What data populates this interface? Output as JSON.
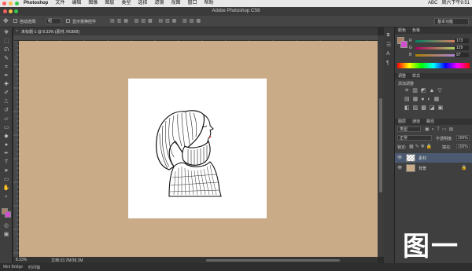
{
  "menubar": {
    "app_name": "Photoshop",
    "items": [
      "文件",
      "编辑",
      "图像",
      "图层",
      "类型",
      "选择",
      "滤镜",
      "视图",
      "窗口",
      "帮助"
    ],
    "right": [
      "ABC",
      "周六下午9:51"
    ]
  },
  "window": {
    "title": "Adobe Photoshop CS6"
  },
  "options": {
    "auto_select_label": "自动选择:",
    "auto_select_value": "组",
    "transform_label": "显示变换控件",
    "workspace": "基本功能"
  },
  "document": {
    "tab_title": "未标题-1 @ 8.33% (素材, RGB/8)",
    "zoom": "8.33%",
    "doc_size": "文档:33.7M/38.2M"
  },
  "bottom_bar": {
    "items": [
      "Mini Bridge",
      "时间轴"
    ]
  },
  "color_panel": {
    "tabs": [
      "颜色",
      "色板"
    ],
    "sliders": [
      {
        "label": "R",
        "value": "173"
      },
      {
        "label": "G",
        "value": "129"
      },
      {
        "label": "B",
        "value": "97"
      }
    ]
  },
  "adjust_panel": {
    "tabs": [
      "调整",
      "样式"
    ],
    "title": "添加调整"
  },
  "layers_panel": {
    "tabs": [
      "图层",
      "通道",
      "路径"
    ],
    "kind": "类型",
    "blend_mode": "正常",
    "opacity_label": "不透明度:",
    "opacity": "100%",
    "lock_label": "锁定:",
    "fill_label": "填充:",
    "fill": "100%",
    "layers": [
      {
        "name": "素材"
      },
      {
        "name": "背景"
      }
    ]
  },
  "figure_label": "图一",
  "colors": {
    "canvas_bg": "#c9ab88",
    "foreground": "#ad8161",
    "background": "#d14fce"
  }
}
